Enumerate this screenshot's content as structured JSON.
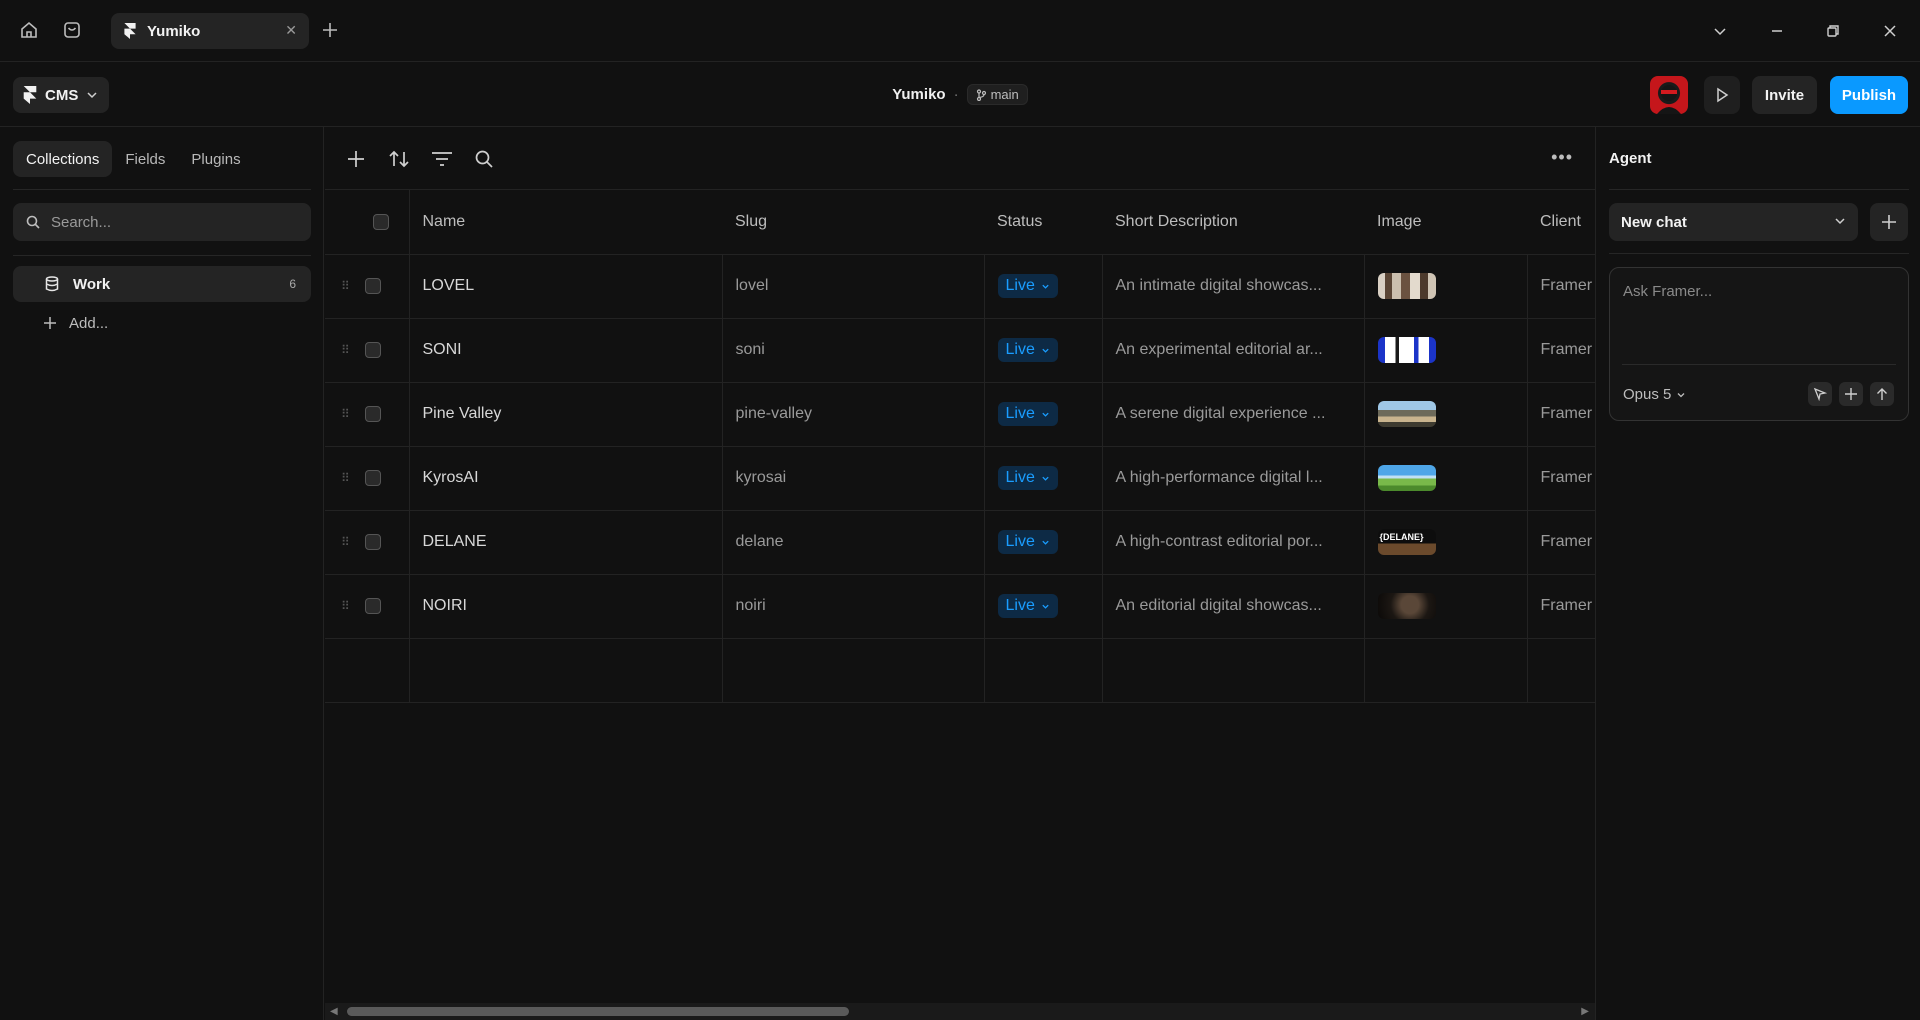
{
  "app": {
    "tab_title": "Yumiko",
    "project_name": "Yumiko",
    "branch": "main",
    "mode_label": "CMS",
    "invite_label": "Invite",
    "publish_label": "Publish",
    "colors": {
      "accent": "#0a99ff",
      "live_text": "#1a9dff",
      "live_bg": "#0d2a45",
      "background": "#111111"
    }
  },
  "sidebar": {
    "tabs": [
      "Collections",
      "Fields",
      "Plugins"
    ],
    "search_placeholder": "Search...",
    "collection": {
      "label": "Work",
      "count": "6"
    },
    "add_label": "Add..."
  },
  "table": {
    "columns": [
      "Name",
      "Slug",
      "Status",
      "Short Description",
      "Image",
      "Client"
    ],
    "rows": [
      {
        "name": "LOVEL",
        "slug": "lovel",
        "status": "Live",
        "desc": "An intimate digital showcas...",
        "client": "Framer"
      },
      {
        "name": "SONI",
        "slug": "soni",
        "status": "Live",
        "desc": "An experimental editorial ar...",
        "client": "Framer"
      },
      {
        "name": "Pine Valley",
        "slug": "pine-valley",
        "status": "Live",
        "desc": "A serene digital experience ...",
        "client": "Framer"
      },
      {
        "name": "KyrosAI",
        "slug": "kyrosai",
        "status": "Live",
        "desc": "A high-performance digital l...",
        "client": "Framer"
      },
      {
        "name": "DELANE",
        "slug": "delane",
        "status": "Live",
        "desc": "A high-contrast editorial por...",
        "client": "Framer"
      },
      {
        "name": "NOIRI",
        "slug": "noiri",
        "status": "Live",
        "desc": "An editorial digital showcas...",
        "client": "Framer"
      }
    ],
    "thumb_text_delane": "{DELANE}"
  },
  "agent": {
    "title": "Agent",
    "chat_select": "New chat",
    "placeholder": "Ask Framer...",
    "model": "Opus 5"
  }
}
